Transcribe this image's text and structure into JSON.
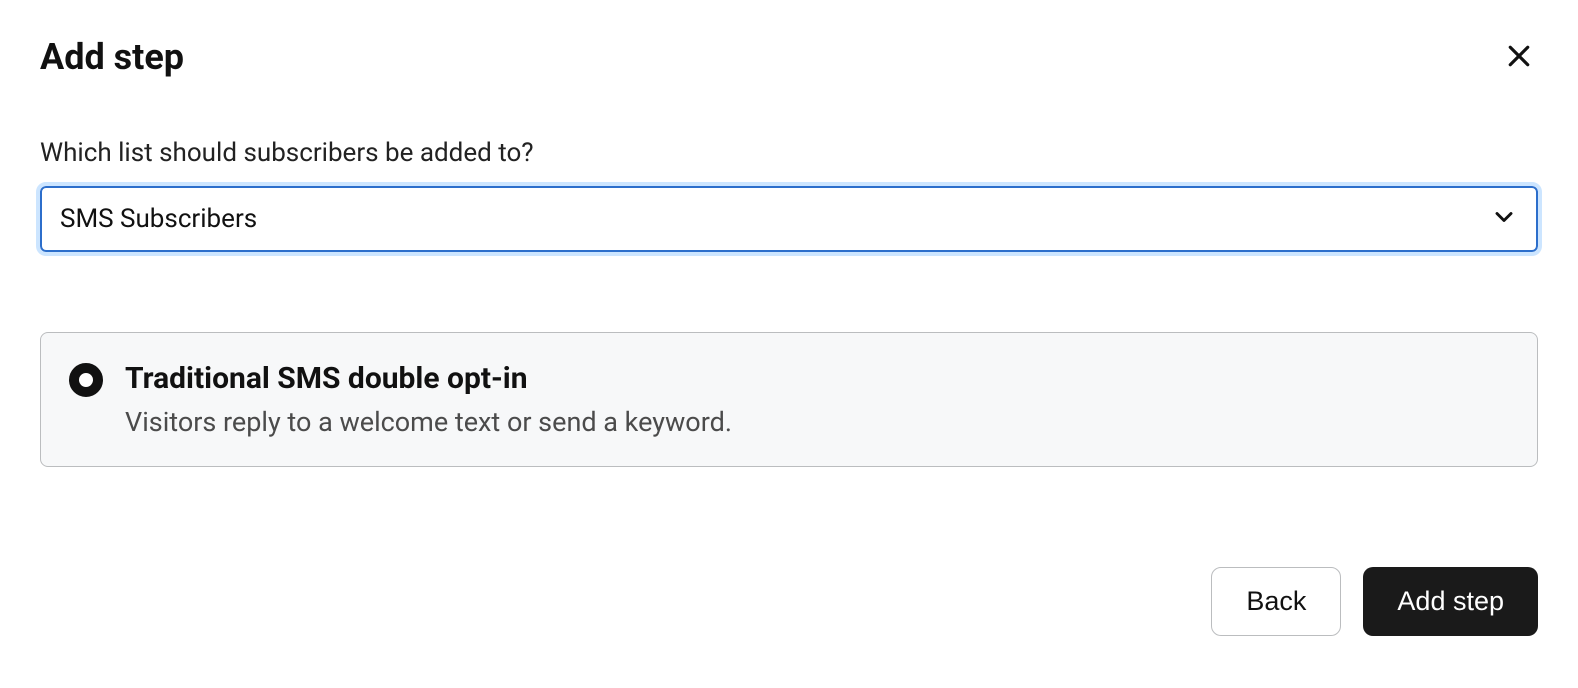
{
  "header": {
    "title": "Add step"
  },
  "form": {
    "list_label": "Which list should subscribers be added to?",
    "list_selected": "SMS Subscribers"
  },
  "option": {
    "title": "Traditional SMS double opt-in",
    "description": "Visitors reply to a welcome text or send a keyword."
  },
  "footer": {
    "back_label": "Back",
    "add_step_label": "Add step"
  }
}
